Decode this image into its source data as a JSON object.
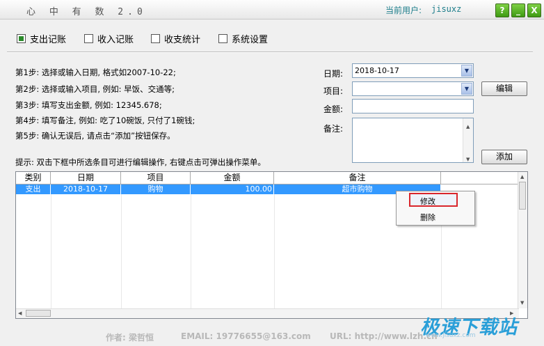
{
  "window": {
    "title": "心 中 有 数  2.0",
    "user_label": "当前用户:",
    "user_name": "jisuxz",
    "help_glyph": "?",
    "min_glyph": "_",
    "close_glyph": "X"
  },
  "tabs": [
    {
      "label": "支出记账",
      "checked": true
    },
    {
      "label": "收入记账",
      "checked": false
    },
    {
      "label": "收支统计",
      "checked": false
    },
    {
      "label": "系统设置",
      "checked": false
    }
  ],
  "steps": [
    "第1步: 选择或输入日期, 格式如2007-10-22;",
    "第2步: 选择或输入项目, 例如: 早饭、交通等;",
    "第3步: 填写支出金额, 例如: 12345.678;",
    "第4步: 填写备注, 例如: 吃了10碗饭, 只付了1碗钱;",
    "第5步: 确认无误后, 请点击“添加”按钮保存。"
  ],
  "form": {
    "date_label": "日期:",
    "date_value": "2018-10-17",
    "item_label": "项目:",
    "item_value": "",
    "amount_label": "金额:",
    "amount_value": "",
    "note_label": "备注:",
    "note_value": "",
    "edit_button": "编辑",
    "add_button": "添加"
  },
  "hint": "提示: 双击下框中所选条目可进行编辑操作, 右键点击可弹出操作菜单。",
  "table": {
    "columns": [
      "类别",
      "日期",
      "项目",
      "金额",
      "备注"
    ],
    "rows": [
      {
        "category": "支出",
        "date": "2018-10-17",
        "item": "购物",
        "amount": "100.00",
        "note": "超市购物"
      }
    ]
  },
  "context_menu": {
    "items": [
      "修改",
      "删除"
    ],
    "highlighted": "修改"
  },
  "footer": {
    "author": "作者: 梁哲恒",
    "email": "EMAIL: 19776655@163.com",
    "url": "URL: http://www.lzh.cn"
  },
  "watermark": {
    "text": "极速下载站",
    "url": "www.jisuxz.com"
  }
}
